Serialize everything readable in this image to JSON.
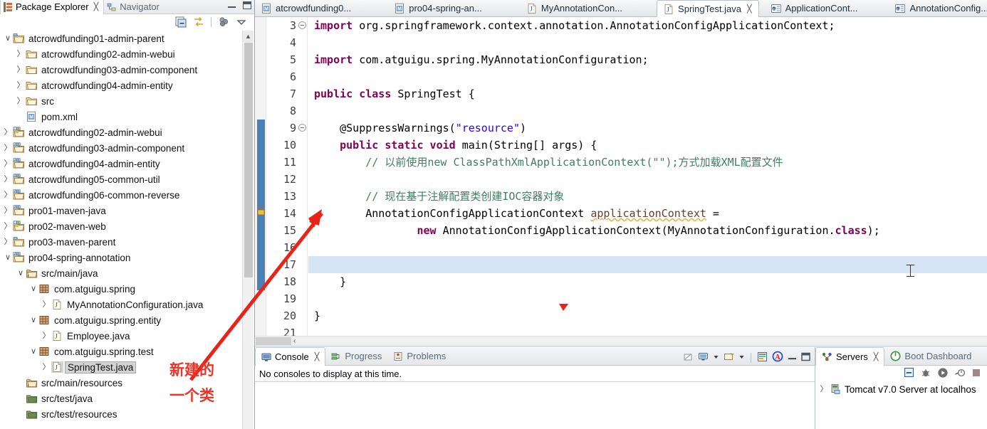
{
  "package_explorer": {
    "tabs": [
      {
        "label": "Package Explorer",
        "icon": "package-explorer-icon",
        "active": true,
        "close": "╳"
      },
      {
        "label": "Navigator",
        "icon": "navigator-icon",
        "active": false
      }
    ],
    "toolbar": [
      {
        "name": "collapse-all-icon"
      },
      {
        "name": "link-with-editor-icon"
      },
      {
        "name": "view-menu-filter-icon"
      },
      {
        "name": "view-menu-icon"
      }
    ],
    "tree": [
      {
        "label": "atcrowdfunding01-admin-parent",
        "indent": 0,
        "twist": "∨",
        "icon": "maven-project-folder-icon"
      },
      {
        "label": "atcrowdfunding02-admin-webui",
        "indent": 1,
        "twist": "〉",
        "icon": "folder-icon"
      },
      {
        "label": "atcrowdfunding03-admin-component",
        "indent": 1,
        "twist": "〉",
        "icon": "folder-icon"
      },
      {
        "label": "atcrowdfunding04-admin-entity",
        "indent": 1,
        "twist": "〉",
        "icon": "folder-icon"
      },
      {
        "label": "src",
        "indent": 1,
        "twist": "〉",
        "icon": "folder-icon"
      },
      {
        "label": "pom.xml",
        "indent": 1,
        "twist": "",
        "icon": "maven-pom-icon"
      },
      {
        "label": "atcrowdfunding02-admin-webui",
        "indent": 0,
        "twist": "〉",
        "icon": "java-web-project-icon"
      },
      {
        "label": "atcrowdfunding03-admin-component",
        "indent": 0,
        "twist": "〉",
        "icon": "java-project-icon"
      },
      {
        "label": "atcrowdfunding04-admin-entity",
        "indent": 0,
        "twist": "〉",
        "icon": "java-project-icon"
      },
      {
        "label": "atcrowdfunding05-common-util",
        "indent": 0,
        "twist": "〉",
        "icon": "java-project-icon"
      },
      {
        "label": "atcrowdfunding06-common-reverse",
        "indent": 0,
        "twist": "〉",
        "icon": "java-project-icon"
      },
      {
        "label": "pro01-maven-java",
        "indent": 0,
        "twist": "〉",
        "icon": "java-project-icon"
      },
      {
        "label": "pro02-maven-web",
        "indent": 0,
        "twist": "〉",
        "icon": "java-web-project-icon"
      },
      {
        "label": "pro03-maven-parent",
        "indent": 0,
        "twist": "〉",
        "icon": "maven-project-folder-icon"
      },
      {
        "label": "pro04-spring-annotation",
        "indent": 0,
        "twist": "∨",
        "icon": "java-project-icon"
      },
      {
        "label": "src/main/java",
        "indent": 1,
        "twist": "∨",
        "icon": "source-folder-icon"
      },
      {
        "label": "com.atguigu.spring",
        "indent": 2,
        "twist": "∨",
        "icon": "package-icon"
      },
      {
        "label": "MyAnnotationConfiguration.java",
        "indent": 3,
        "twist": "〉",
        "icon": "java-file-icon"
      },
      {
        "label": "com.atguigu.spring.entity",
        "indent": 2,
        "twist": "∨",
        "icon": "package-icon"
      },
      {
        "label": "Employee.java",
        "indent": 3,
        "twist": "〉",
        "icon": "java-file-icon"
      },
      {
        "label": "com.atguigu.spring.test",
        "indent": 2,
        "twist": "∨",
        "icon": "package-icon"
      },
      {
        "label": "SpringTest.java",
        "indent": 3,
        "twist": "〉",
        "icon": "java-file-icon",
        "selected": true
      },
      {
        "label": "src/main/resources",
        "indent": 1,
        "twist": "",
        "icon": "source-folder-icon"
      },
      {
        "label": "src/test/java",
        "indent": 1,
        "twist": "",
        "icon": "test-source-folder-icon"
      },
      {
        "label": "src/test/resources",
        "indent": 1,
        "twist": "",
        "icon": "test-source-folder-icon"
      }
    ]
  },
  "editor": {
    "tabs": [
      {
        "label": "atcrowdfunding0...",
        "icon": "maven-pom-icon",
        "active": false
      },
      {
        "label": "pro04-spring-an...",
        "icon": "maven-pom-icon",
        "active": false
      },
      {
        "label": "MyAnnotationCon...",
        "icon": "java-file-icon",
        "active": false
      },
      {
        "label": "SpringTest.java",
        "icon": "java-file-icon",
        "active": true,
        "close": "╳"
      },
      {
        "label": "ApplicationCont...",
        "icon": "java-class-lib-icon",
        "active": false
      },
      {
        "label": "AnnotationConfig...",
        "icon": "java-class-lib-icon",
        "active": false
      }
    ],
    "line_numbers": [
      "3",
      "4",
      "5",
      "6",
      "7",
      "8",
      "9",
      "10",
      "11",
      "12",
      "13",
      "14",
      "15",
      "16",
      "17",
      "18",
      "19",
      "20",
      "21"
    ],
    "folding_lines": [
      "3",
      "9"
    ],
    "warning_line": "14",
    "current_line": "17",
    "lines": [
      {
        "n": "3",
        "segments": [
          {
            "t": "import",
            "c": "kw"
          },
          {
            "t": " org.springframework.context.annotation.AnnotationConfigApplicationContext;",
            "c": "plain"
          }
        ]
      },
      {
        "n": "4",
        "segments": []
      },
      {
        "n": "5",
        "segments": [
          {
            "t": "import",
            "c": "kw"
          },
          {
            "t": " com.atguigu.spring.MyAnnotationConfiguration;",
            "c": "plain"
          }
        ]
      },
      {
        "n": "6",
        "segments": []
      },
      {
        "n": "7",
        "segments": [
          {
            "t": "public class",
            "c": "kw"
          },
          {
            "t": " SpringTest {",
            "c": "plain"
          }
        ]
      },
      {
        "n": "8",
        "segments": []
      },
      {
        "n": "9",
        "segments": [
          {
            "t": "    @SuppressWarnings(",
            "c": "plain"
          },
          {
            "t": "\"resource\"",
            "c": "str"
          },
          {
            "t": ")",
            "c": "plain"
          }
        ]
      },
      {
        "n": "10",
        "segments": [
          {
            "t": "    ",
            "c": "plain"
          },
          {
            "t": "public static void",
            "c": "kw"
          },
          {
            "t": " main(String[] args) {",
            "c": "plain"
          }
        ]
      },
      {
        "n": "11",
        "segments": [
          {
            "t": "        // 以前使用new ClassPathXmlApplicationContext(\"\");方式加载XML配置文件",
            "c": "cmt"
          }
        ]
      },
      {
        "n": "12",
        "segments": []
      },
      {
        "n": "13",
        "segments": [
          {
            "t": "        // 现在基于注解配置类创建IOC容器对象",
            "c": "cmt"
          }
        ]
      },
      {
        "n": "14",
        "segments": [
          {
            "t": "        AnnotationConfigApplicationContext ",
            "c": "plain"
          },
          {
            "t": "applicationContext",
            "c": "fieldname"
          },
          {
            "t": " =",
            "c": "plain"
          }
        ]
      },
      {
        "n": "15",
        "segments": [
          {
            "t": "                ",
            "c": "plain"
          },
          {
            "t": "new",
            "c": "kw"
          },
          {
            "t": " AnnotationConfigApplicationContext(MyAnnotationConfiguration.",
            "c": "plain"
          },
          {
            "t": "class",
            "c": "kw"
          },
          {
            "t": ");",
            "c": "plain"
          }
        ]
      },
      {
        "n": "16",
        "segments": []
      },
      {
        "n": "17",
        "segments": []
      },
      {
        "n": "18",
        "segments": [
          {
            "t": "    }",
            "c": "plain"
          }
        ]
      },
      {
        "n": "19",
        "segments": []
      },
      {
        "n": "20",
        "segments": [
          {
            "t": "}",
            "c": "plain"
          }
        ]
      },
      {
        "n": "21",
        "segments": []
      }
    ],
    "hscroll_left_arrow": "‹"
  },
  "console": {
    "tabs": [
      {
        "label": "Console",
        "icon": "console-icon",
        "active": true,
        "close": "╳"
      },
      {
        "label": "Progress",
        "icon": "progress-icon",
        "active": false
      },
      {
        "label": "Problems",
        "icon": "problems-icon",
        "active": false
      }
    ],
    "toolbar": [
      {
        "name": "clear-console-icon"
      },
      {
        "name": "display-selected-console-icon"
      },
      {
        "name": "display-selected-console-dropdown-icon"
      },
      {
        "name": "open-console-icon"
      },
      {
        "name": "open-console-dropdown-icon"
      },
      {
        "name": "word-wrap-icon"
      },
      {
        "name": "ansi-console-icon"
      },
      {
        "name": "minimize-icon"
      },
      {
        "name": "maximize-icon"
      }
    ],
    "message": "No consoles to display at this time."
  },
  "servers": {
    "tabs": [
      {
        "label": "Servers",
        "icon": "servers-icon",
        "active": true,
        "close": "╳"
      },
      {
        "label": "Boot Dashboard",
        "icon": "boot-dashboard-icon",
        "active": false
      }
    ],
    "toolbar": [
      {
        "name": "collapse-all-icon"
      },
      {
        "name": "debug-server-icon"
      },
      {
        "name": "start-server-icon"
      },
      {
        "name": "profile-server-icon"
      },
      {
        "name": "stop-server-icon"
      }
    ],
    "items": [
      {
        "label": "Tomcat v7.0 Server at localhos",
        "twist": "〉",
        "icon": "tomcat-server-icon"
      }
    ]
  },
  "annotations": {
    "note_line1": "新建的",
    "note_line2": "一个类",
    "note_color": "#ee3326",
    "arrow_color": "#e8241a"
  }
}
